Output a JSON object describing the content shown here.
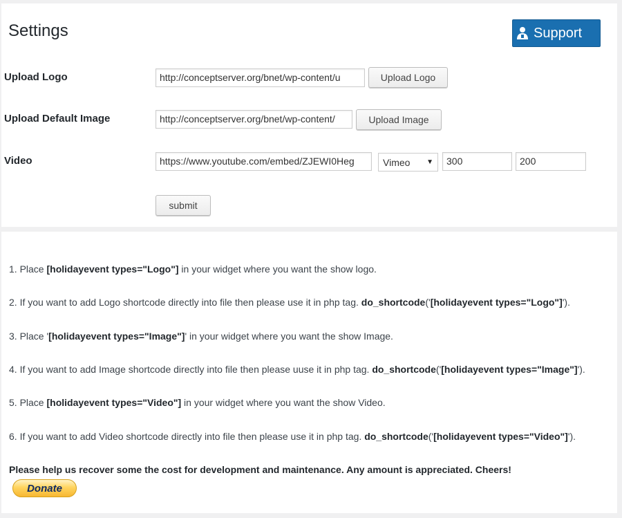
{
  "header": {
    "title": "Settings",
    "support_label": "Support"
  },
  "form": {
    "logo": {
      "label": "Upload Logo",
      "value": "http://conceptserver.org/bnet/wp-content/u",
      "button": "Upload Logo"
    },
    "default_image": {
      "label": "Upload Default Image",
      "value": "http://conceptserver.org/bnet/wp-content/",
      "button": "Upload Image"
    },
    "video": {
      "label": "Video",
      "value": "https://www.youtube.com/embed/ZJEWI0Heg",
      "provider": "Vimeo",
      "width": "300",
      "height": "200"
    },
    "submit_label": "submit"
  },
  "instructions": [
    {
      "pre": "1. Place ",
      "bold": "[holidayevent types=\"Logo\"]",
      "post": " in your widget where you want the show logo."
    },
    {
      "pre": "2. If you want to add Logo shortcode directly into file then please use it in php tag. ",
      "bold": "do_shortcode",
      "post": "('",
      "bold2": "[holidayevent types=\"Logo\"]",
      "post2": "')."
    },
    {
      "pre": "3. Place '",
      "bold": "[holidayevent types=\"Image\"]",
      "post": "' in your widget where you want the show Image."
    },
    {
      "pre": "4. If you want to add Image shortcode directly into file then please uuse it in php tag. ",
      "bold": "do_shortcode",
      "post": "('",
      "bold2": "[holidayevent types=\"Image\"]",
      "post2": "')."
    },
    {
      "pre": "5. Place ",
      "bold": "[holidayevent types=\"Video\"]",
      "post": " in your widget where you want the show Video."
    },
    {
      "pre": "6. If you want to add Video shortcode directly into file then please use it in php tag. ",
      "bold": "do_shortcode",
      "post": "('",
      "bold2": "[holidayevent types=\"Video\"]",
      "post2": "')."
    }
  ],
  "help_text": "Please help us recover some the cost for development and maintenance. Any amount is appreciated. Cheers!",
  "donate_label": "Donate",
  "colors": {
    "support_bg": "#1a6fb0",
    "donate_bg": "#ffd45e"
  },
  "icons": {
    "support": "user-icon"
  }
}
